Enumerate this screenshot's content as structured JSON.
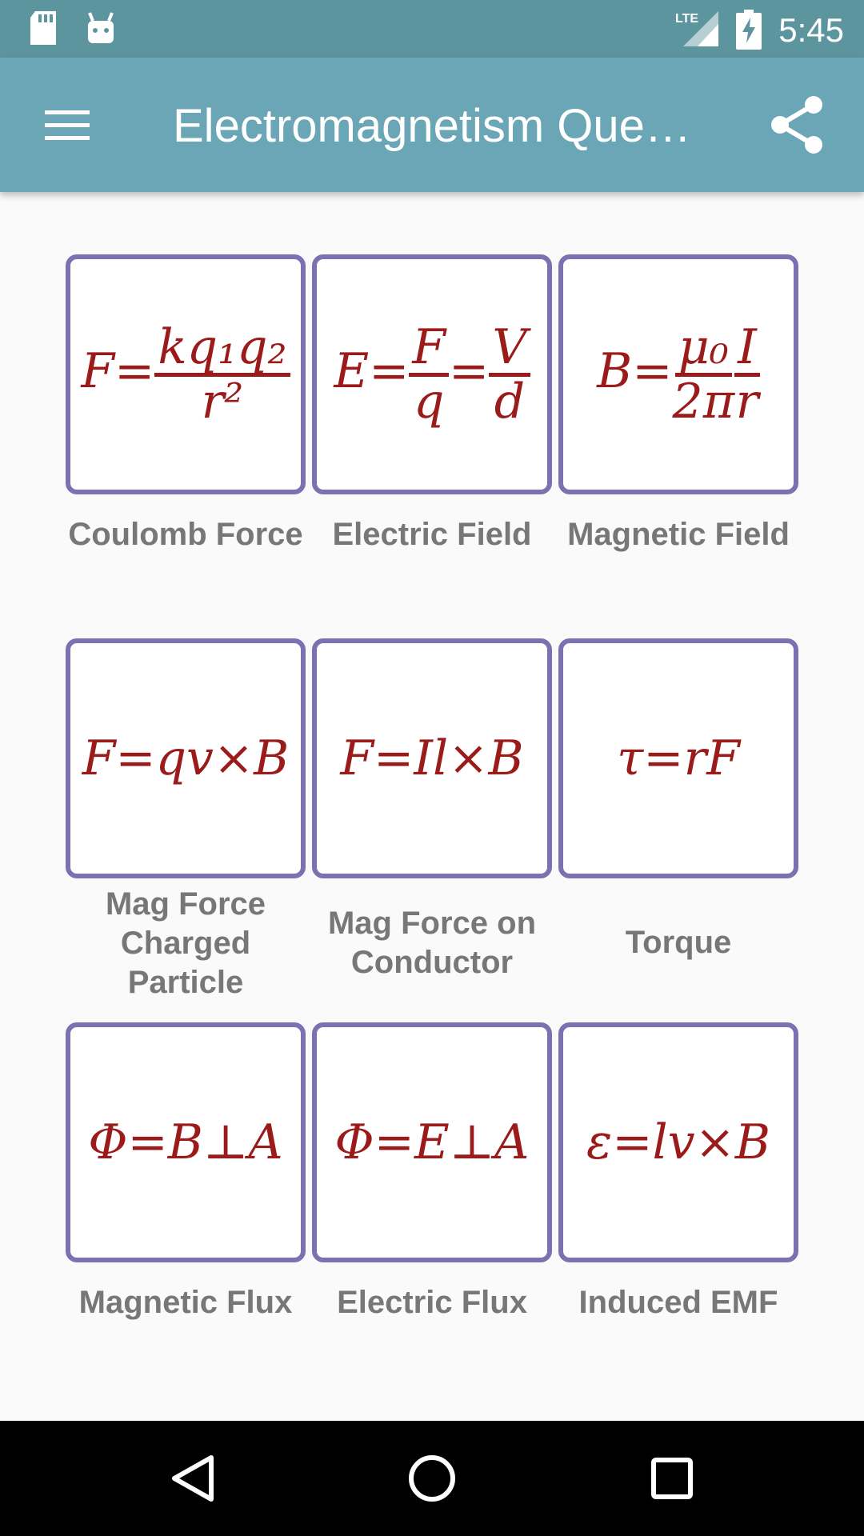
{
  "status_bar": {
    "time": "5:45",
    "network": "LTE",
    "icons": [
      "sd-card-icon",
      "android-icon",
      "lte-signal-icon",
      "battery-charging-icon"
    ]
  },
  "app_bar": {
    "title": "Electromagnetism Que…",
    "menu_icon": "hamburger-menu-icon",
    "share_icon": "share-icon"
  },
  "colors": {
    "status_bar": "#5d959f",
    "app_bar": "#6aa6b6",
    "card_border": "#7a72b0",
    "formula": "#9b1b1b",
    "label": "#777777",
    "background": "#fafafa",
    "nav_bar": "#000000"
  },
  "grid": [
    {
      "formula": "F=kq₁q₂/r²",
      "label": "Coulomb Force"
    },
    {
      "formula": "E=F/q=V/d",
      "label": "Electric Field"
    },
    {
      "formula": "B=μ₀/2π · I/r",
      "label": "Magnetic Field"
    },
    {
      "formula": "F=qv×B",
      "label": "Mag Force Charged Particle"
    },
    {
      "formula": "F=Il×B",
      "label": "Mag Force on Conductor"
    },
    {
      "formula": "τ=rF",
      "label": "Torque"
    },
    {
      "formula": "Φ=B⊥A",
      "label": "Magnetic Flux"
    },
    {
      "formula": "Φ=E⊥A",
      "label": "Electric Flux"
    },
    {
      "formula": "ε=lv×B",
      "label": "Induced EMF"
    }
  ],
  "nav_bar": {
    "icons": [
      "back-icon",
      "home-icon",
      "recents-icon"
    ]
  }
}
